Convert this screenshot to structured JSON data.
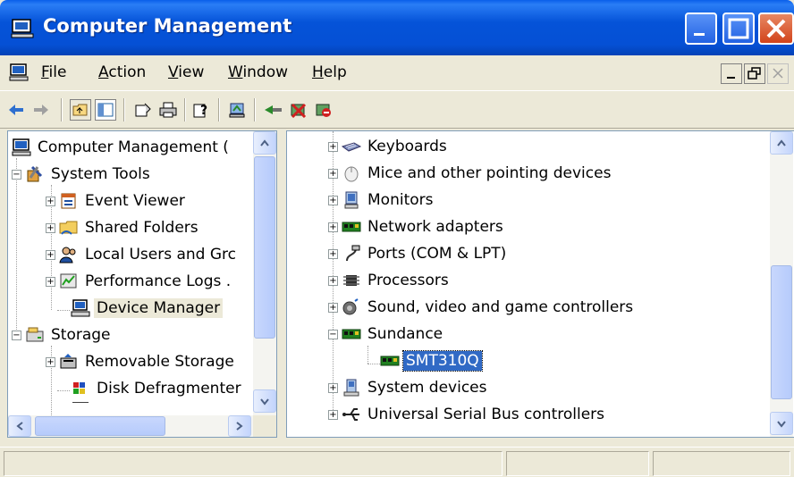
{
  "window": {
    "title": "Computer Management",
    "icon": "computer-management-icon"
  },
  "menu": {
    "items": [
      "File",
      "Action",
      "View",
      "Window",
      "Help"
    ],
    "mnemonics": [
      "F",
      "A",
      "V",
      "W",
      "H"
    ]
  },
  "left_tree": {
    "items": [
      {
        "label": "Computer Management (",
        "icon": "computer-icon"
      },
      {
        "label": "System Tools",
        "icon": "tools-icon"
      },
      {
        "label": "Event Viewer",
        "icon": "event-viewer-icon"
      },
      {
        "label": "Shared Folders",
        "icon": "folder-icon"
      },
      {
        "label": "Local Users and Grc",
        "icon": "users-icon"
      },
      {
        "label": "Performance Logs .",
        "icon": "performance-icon"
      },
      {
        "label": "Device Manager",
        "icon": "device-manager-icon"
      },
      {
        "label": "Storage",
        "icon": "storage-icon"
      },
      {
        "label": "Removable Storage",
        "icon": "removable-storage-icon"
      },
      {
        "label": "Disk Defragmenter",
        "icon": "defrag-icon"
      }
    ]
  },
  "right_tree": {
    "items": [
      {
        "label": "Keyboards",
        "icon": "keyboard-icon"
      },
      {
        "label": "Mice and other pointing devices",
        "icon": "mouse-icon"
      },
      {
        "label": "Monitors",
        "icon": "monitor-icon"
      },
      {
        "label": "Network adapters",
        "icon": "network-adapter-icon"
      },
      {
        "label": "Ports (COM & LPT)",
        "icon": "port-icon"
      },
      {
        "label": "Processors",
        "icon": "processor-icon"
      },
      {
        "label": "Sound, video and game controllers",
        "icon": "sound-icon"
      },
      {
        "label": "Sundance",
        "icon": "card-icon"
      },
      {
        "label": "SMT310Q",
        "icon": "card-icon"
      },
      {
        "label": "System devices",
        "icon": "system-icon"
      },
      {
        "label": "Universal Serial Bus controllers",
        "icon": "usb-icon"
      }
    ]
  },
  "colors": {
    "titlebar": "#0553D8",
    "selection": "#316AC5",
    "chrome": "#ECE9D8"
  }
}
